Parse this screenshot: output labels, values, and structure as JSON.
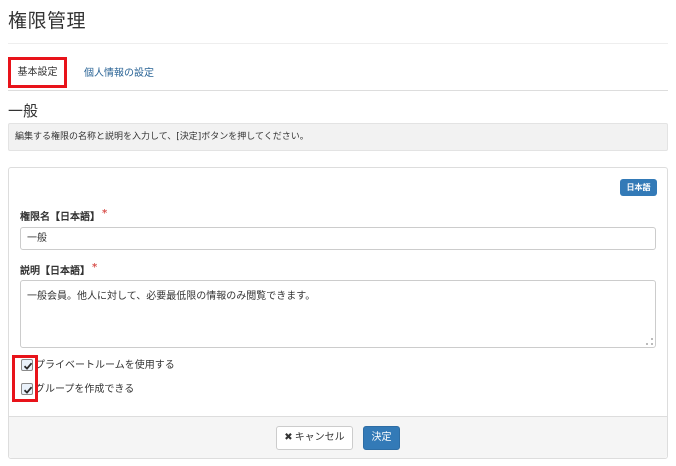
{
  "page": {
    "title": "権限管理"
  },
  "tabs": [
    {
      "label": "基本設定",
      "active": true
    },
    {
      "label": "個人情報の設定",
      "active": false
    }
  ],
  "section": {
    "title": "一般"
  },
  "info": {
    "text": "編集する権限の名称と説明を入力して、[決定]ボタンを押してください。"
  },
  "form": {
    "language_badge": "日本語",
    "name_label": "権限名【日本語】",
    "name_value": "一般",
    "description_label": "説明【日本語】",
    "description_value": "一般会員。他人に対して、必要最低限の情報のみ閲覧できます。",
    "required_mark": "*",
    "checkboxes": [
      {
        "label": "プライベートルームを使用する",
        "checked": true
      },
      {
        "label": "グループを作成できる",
        "checked": true
      }
    ]
  },
  "footer": {
    "cancel_label": "キャンセル",
    "cancel_icon": "close-icon",
    "submit_label": "決定"
  },
  "colors": {
    "primary": "#337ab7",
    "highlight": "#e8131a",
    "required": "#d9534f"
  }
}
